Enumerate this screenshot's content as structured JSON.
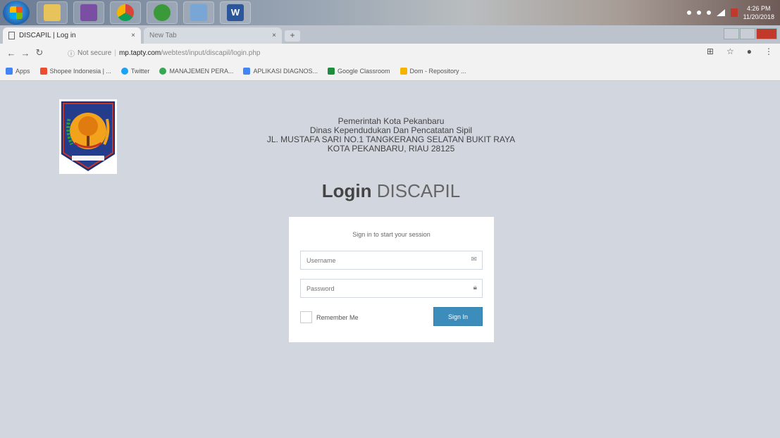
{
  "taskbar": {
    "clock_time": "4:26 PM",
    "clock_date": "11/20/2018",
    "word_label": "W"
  },
  "tabs": [
    {
      "label": "DISCAPIL | Log in",
      "close": "×"
    },
    {
      "label": "New Tab",
      "close": "×"
    }
  ],
  "newtab_label": "+",
  "address": {
    "security": "Not secure",
    "host": "mp.tapty.com",
    "path": "/webtest/input/discapil/login.php"
  },
  "bookmarks": [
    {
      "label": "Apps",
      "color": "#4285f4"
    },
    {
      "label": "Shopee Indonesia | ...",
      "color": "#ee4d2d"
    },
    {
      "label": "Twitter",
      "color": "#1da1f2"
    },
    {
      "label": "MANAJEMEN PERA...",
      "color": "#34a853"
    },
    {
      "label": "APLIKASI DIAGNOS...",
      "color": "#4285f4"
    },
    {
      "label": "Google Classroom",
      "color": "#1e8e3e"
    },
    {
      "label": "Dom - Repository ...",
      "color": "#f4b400"
    }
  ],
  "header": {
    "line1": "Pemerintah Kota Pekanbaru",
    "line2": "Dinas Kependudukan Dan Pencatatan Sipil",
    "line3": "JL. MUSTAFA SARI NO.1 TANGKERANG SELATAN BUKIT RAYA",
    "line4": "KOTA PEKANBARU, RIAU 28125"
  },
  "login_title": {
    "bold": "Login",
    "light": "DISCAPIL"
  },
  "form": {
    "message": "Sign in to start your session",
    "username_placeholder": "Username",
    "password_placeholder": "Password",
    "remember_label": "Remember Me",
    "signin_label": "Sign In"
  },
  "colors": {
    "page_bg": "#d2d6de",
    "signin_button": "#3c8dbc"
  }
}
